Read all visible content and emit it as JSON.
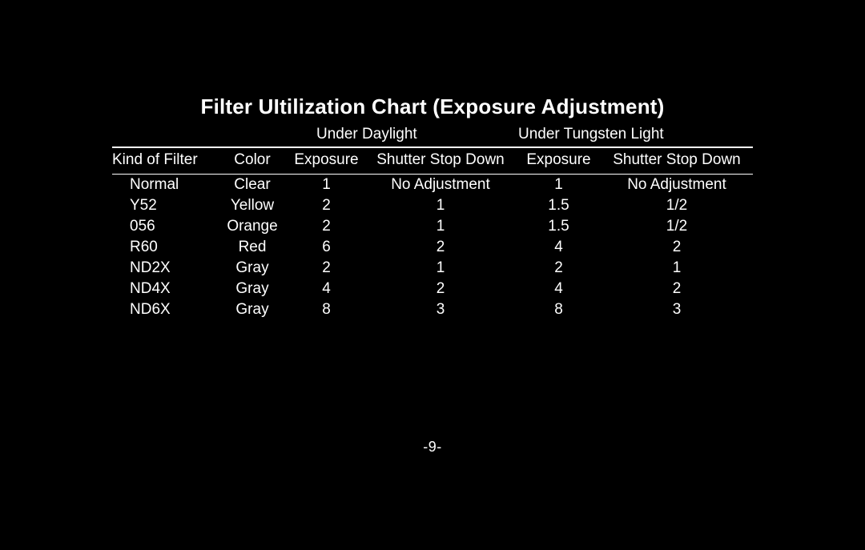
{
  "title": "Filter UItilization Chart  (Exposure Adjustment)",
  "groups": {
    "daylight": "Under Daylight",
    "tungsten": "Under Tungsten Light"
  },
  "columns": {
    "kind": "Kind of Filter",
    "color": "Color",
    "exposure_day": "Exposure",
    "ssd_day": "Shutter Stop Down",
    "exposure_tun": "Exposure",
    "ssd_tun": "Shutter Stop Down"
  },
  "rows": [
    {
      "kind": "Normal",
      "color": "Clear",
      "exp_day": "1",
      "ssd_day": "No Adjustment",
      "exp_tun": "1",
      "ssd_tun": "No Adjustment"
    },
    {
      "kind": "Y52",
      "color": "Yellow",
      "exp_day": "2",
      "ssd_day": "1",
      "exp_tun": "1.5",
      "ssd_tun": "1/2"
    },
    {
      "kind": "056",
      "color": "Orange",
      "exp_day": "2",
      "ssd_day": "1",
      "exp_tun": "1.5",
      "ssd_tun": "1/2"
    },
    {
      "kind": "R60",
      "color": "Red",
      "exp_day": "6",
      "ssd_day": "2",
      "exp_tun": "4",
      "ssd_tun": "2"
    },
    {
      "kind": "ND2X",
      "color": "Gray",
      "exp_day": "2",
      "ssd_day": "1",
      "exp_tun": "2",
      "ssd_tun": "1"
    },
    {
      "kind": "ND4X",
      "color": "Gray",
      "exp_day": "4",
      "ssd_day": "2",
      "exp_tun": "4",
      "ssd_tun": "2"
    },
    {
      "kind": "ND6X",
      "color": "Gray",
      "exp_day": "8",
      "ssd_day": "3",
      "exp_tun": "8",
      "ssd_tun": "3"
    }
  ],
  "chart_data": {
    "type": "table",
    "title": "Filter UItilization Chart  (Exposure Adjustment)",
    "group_headers": [
      "Under Daylight",
      "Under Tungsten Light"
    ],
    "columns": [
      "Kind of Filter",
      "Color",
      "Exposure",
      "Shutter Stop Down",
      "Exposure",
      "Shutter Stop Down"
    ],
    "data": [
      [
        "Normal",
        "Clear",
        "1",
        "No Adjustment",
        "1",
        "No Adjustment"
      ],
      [
        "Y52",
        "Yellow",
        "2",
        "1",
        "1.5",
        "1/2"
      ],
      [
        "056",
        "Orange",
        "2",
        "1",
        "1.5",
        "1/2"
      ],
      [
        "R60",
        "Red",
        "6",
        "2",
        "4",
        "2"
      ],
      [
        "ND2X",
        "Gray",
        "2",
        "1",
        "2",
        "1"
      ],
      [
        "ND4X",
        "Gray",
        "4",
        "2",
        "4",
        "2"
      ],
      [
        "ND6X",
        "Gray",
        "8",
        "3",
        "8",
        "3"
      ]
    ]
  },
  "page_number": "-9-"
}
